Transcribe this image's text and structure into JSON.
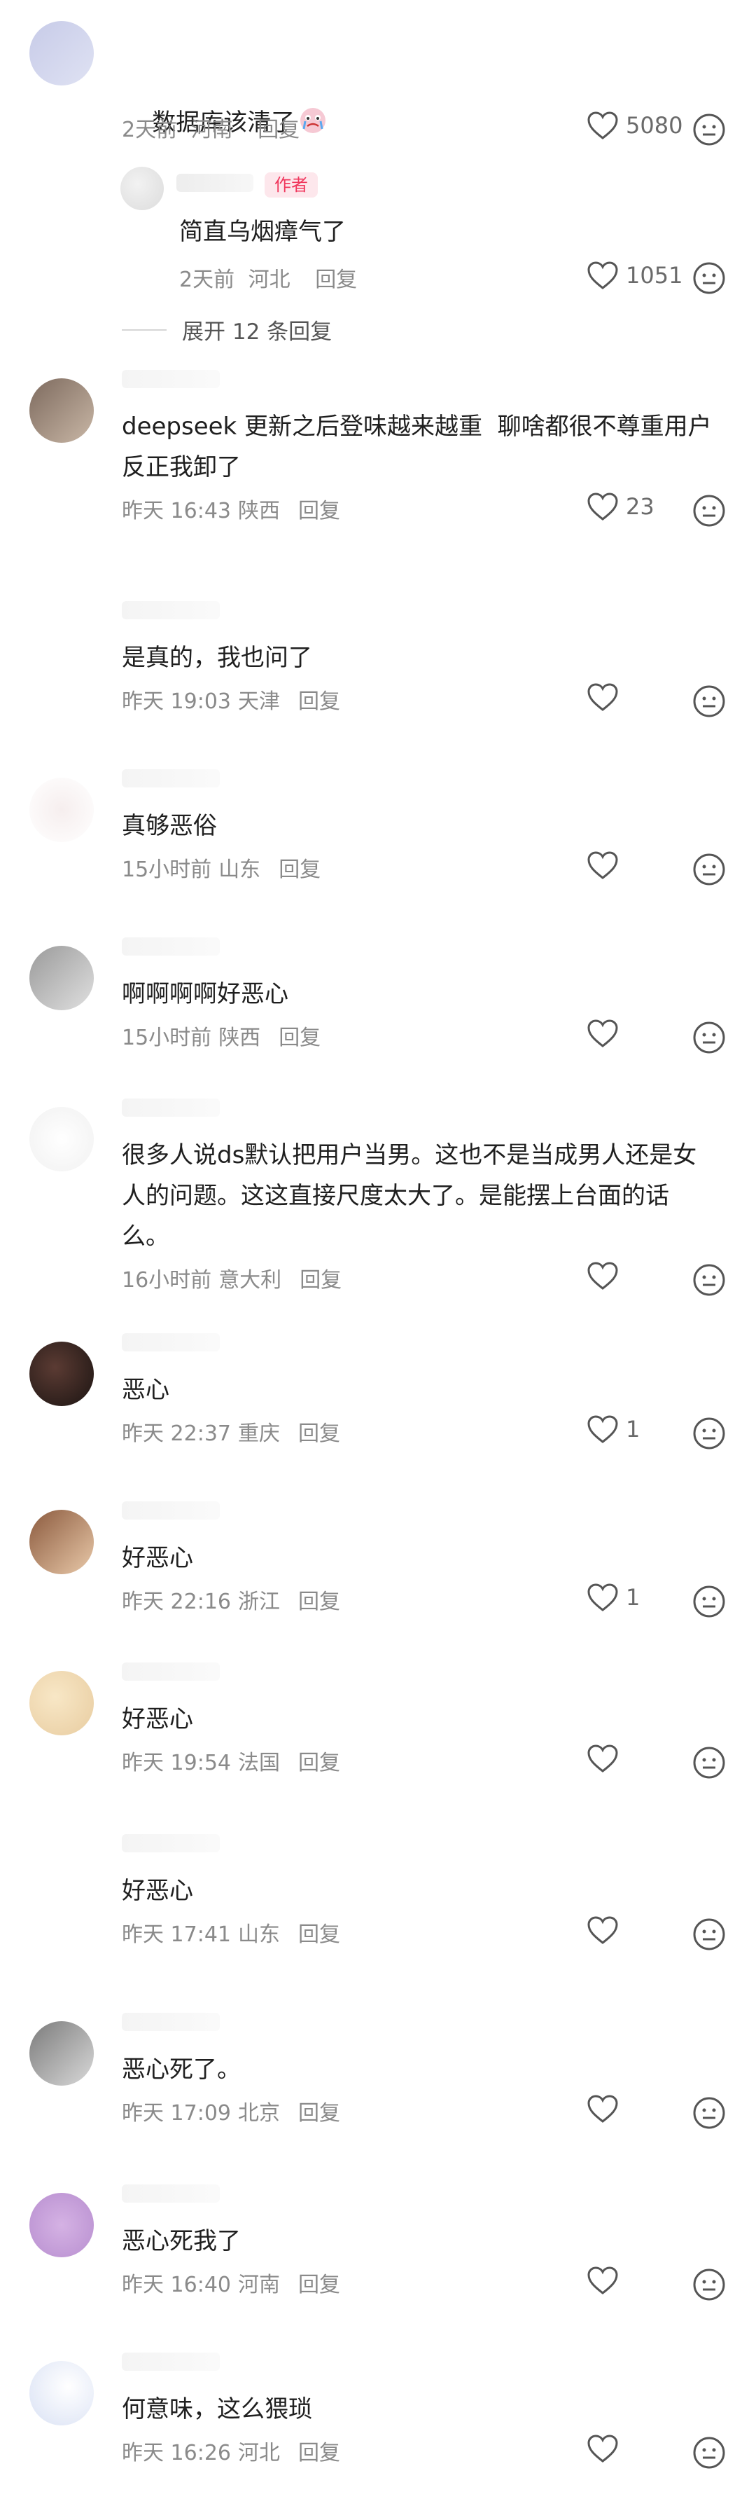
{
  "comments": [
    {
      "text": "数据库该清了",
      "time": "2天前",
      "loc": "河南",
      "reply": "回复",
      "likes": "5080",
      "emoji": "crying-face-emoji"
    },
    {
      "text": "简直乌烟瘴气了",
      "time": "2天前",
      "loc": "河北",
      "reply": "回复",
      "likes": "1051",
      "badge": "作者"
    },
    {
      "expand": "展开 12 条回复"
    },
    {
      "text": "deepseek 更新之后登味越来越重  聊啥都很不尊重用户  反正我卸了",
      "time": "昨天 16:43",
      "loc": "陕西",
      "reply": "回复",
      "likes": "23"
    },
    {
      "text": "是真的，我也问了",
      "time": "昨天 19:03",
      "loc": "天津",
      "reply": "回复",
      "likes": ""
    },
    {
      "text": "真够恶俗",
      "time": "15小时前",
      "loc": "山东",
      "reply": "回复",
      "likes": ""
    },
    {
      "text": "啊啊啊啊好恶心",
      "time": "15小时前",
      "loc": "陕西",
      "reply": "回复",
      "likes": ""
    },
    {
      "text": "很多人说ds默认把用户当男。这也不是当成男人还是女人的问题。这这直接尺度太大了。是能摆上台面的话么。",
      "time": "16小时前",
      "loc": "意大利",
      "reply": "回复",
      "likes": ""
    },
    {
      "text": "恶心",
      "time": "昨天 22:37",
      "loc": "重庆",
      "reply": "回复",
      "likes": "1"
    },
    {
      "text": "好恶心",
      "time": "昨天 22:16",
      "loc": "浙江",
      "reply": "回复",
      "likes": "1"
    },
    {
      "text": "好恶心",
      "time": "昨天 19:54",
      "loc": "法国",
      "reply": "回复",
      "likes": ""
    },
    {
      "text": "好恶心",
      "time": "昨天 17:41",
      "loc": "山东",
      "reply": "回复",
      "likes": ""
    },
    {
      "text": "恶心死了。",
      "time": "昨天 17:09",
      "loc": "北京",
      "reply": "回复",
      "likes": ""
    },
    {
      "text": "恶心死我了",
      "time": "昨天 16:40",
      "loc": "河南",
      "reply": "回复",
      "likes": ""
    },
    {
      "text": "何意味，这么猥琐",
      "time": "昨天 16:26",
      "loc": "河北",
      "reply": "回复",
      "likes": ""
    }
  ],
  "colors": {
    "accent": "#f0365c",
    "meta": "#8a8a8a",
    "text": "#1f1f1f"
  }
}
